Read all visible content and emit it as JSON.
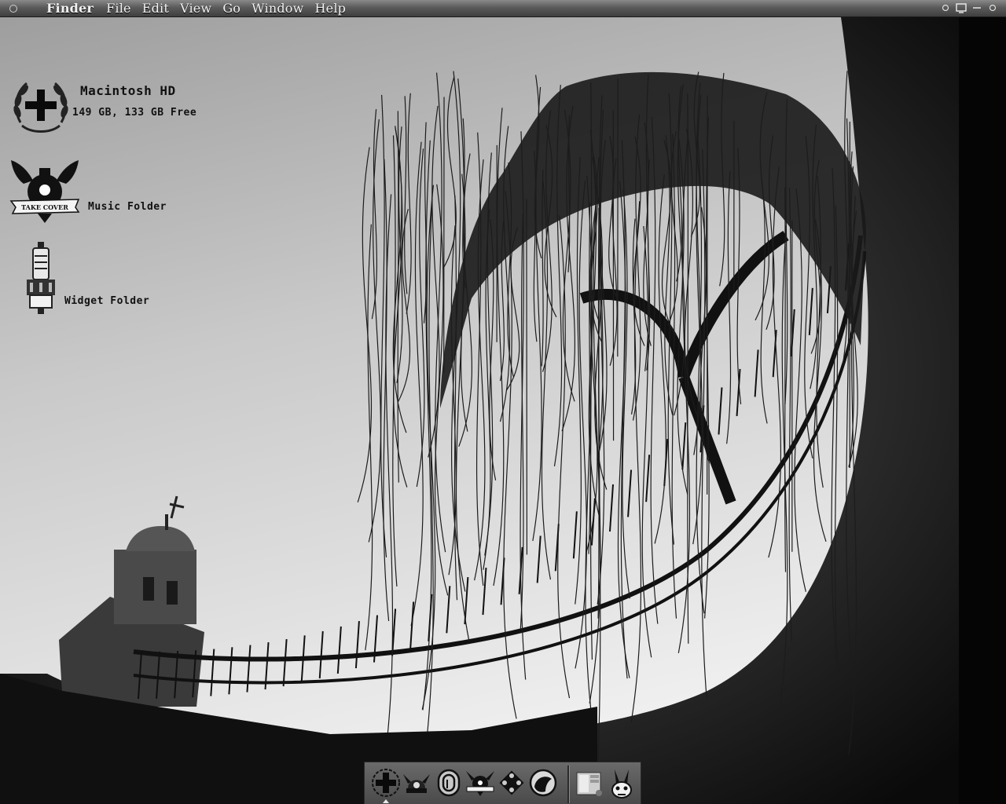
{
  "menubar": {
    "app_name": "Finder",
    "items": [
      "File",
      "Edit",
      "View",
      "Go",
      "Window",
      "Help"
    ],
    "apple_icon": "circle-menu-icon",
    "status_icons": [
      "record-icon",
      "display-icon",
      "minimize-icon",
      "circle-icon"
    ]
  },
  "desktop": {
    "hard_drive": {
      "name": "Macintosh HD",
      "info": "149 GB, 133 GB Free",
      "icon": "laurel-cross-icon"
    },
    "music_folder": {
      "name": "Music Folder",
      "icon": "take-cover-folder-icon",
      "badge_text": "TAKE COVER"
    },
    "widget_folder": {
      "name": "Widget Folder",
      "icon": "spark-plug-folder-icon"
    }
  },
  "dock": {
    "apps": [
      {
        "name": "finder",
        "icon": "cross-laurel-icon"
      },
      {
        "name": "mail",
        "icon": "helmet-icon"
      },
      {
        "name": "itunes",
        "icon": "paperclip-icon"
      },
      {
        "name": "take-cover",
        "icon": "winged-bomb-icon"
      },
      {
        "name": "network",
        "icon": "diamond-icon"
      },
      {
        "name": "astronaut",
        "icon": "head-icon"
      }
    ],
    "others": [
      {
        "name": "document",
        "icon": "document-stack-icon"
      },
      {
        "name": "trash",
        "icon": "rabbit-icon"
      }
    ]
  },
  "colors": {
    "menubar": "#5b5b5b",
    "sky": "#c8c8c8",
    "silhouette": "#0d0d0d"
  }
}
